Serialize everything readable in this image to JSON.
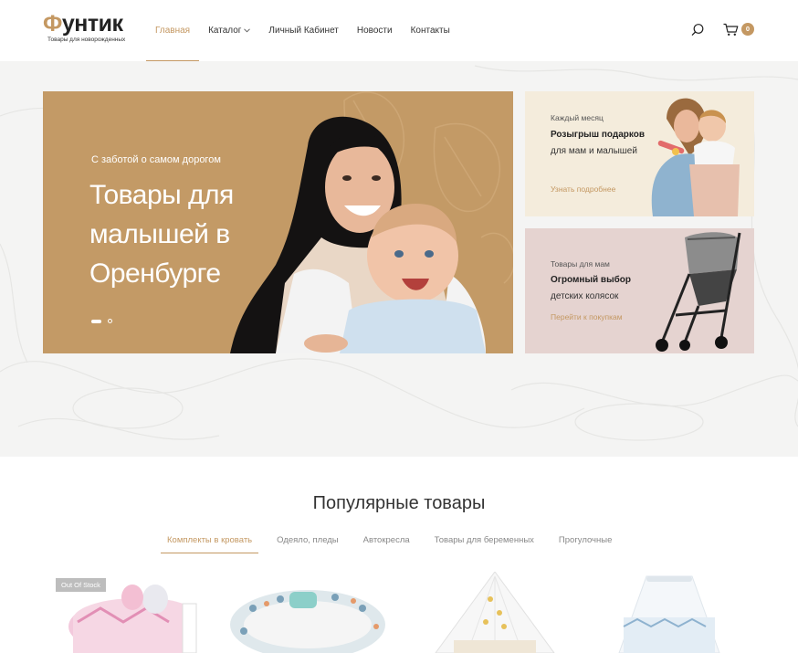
{
  "header": {
    "logo_title_first": "Ф",
    "logo_title_rest": "унтик",
    "logo_subtitle": "Товары для новорожденных",
    "nav": [
      {
        "label": "Главная"
      },
      {
        "label": "Каталог"
      },
      {
        "label": "Личный Кабинет"
      },
      {
        "label": "Новости"
      },
      {
        "label": "Контакты"
      }
    ],
    "cart_count": "0"
  },
  "hero": {
    "pre": "С заботой о самом дорогом",
    "title": "Товары для малышей в Оренбурге"
  },
  "promo1": {
    "pre": "Каждый месяц",
    "bold": "Розыгрыш подарков",
    "rest": " для мам и малышей",
    "link": "Узнать подробнее"
  },
  "promo2": {
    "pre": "Товары для мам",
    "bold": "Огромный выбор",
    "rest": " детских колясок",
    "link": "Перейти к покупкам"
  },
  "popular": {
    "title": "Популярные товары",
    "tabs": [
      {
        "label": "Комплекты в кровать"
      },
      {
        "label": "Одеяло, пледы"
      },
      {
        "label": "Автокресла"
      },
      {
        "label": "Товары для беременных"
      },
      {
        "label": "Прогулочные"
      }
    ],
    "badge": "Out Of Stock"
  },
  "colors": {
    "accent": "#c49862",
    "banner": "#c39a66",
    "promo1_bg": "#f4ecdc",
    "promo2_bg": "#e5d3d0",
    "hero_bg": "#f4f4f3"
  },
  "icons": [
    "search-icon",
    "cart-icon",
    "chevron-down-icon"
  ]
}
